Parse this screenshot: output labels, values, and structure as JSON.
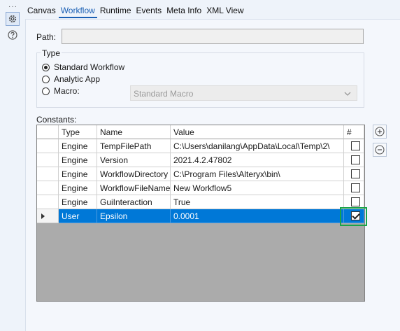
{
  "toolbar": {
    "dots": "···",
    "icons": [
      "gear-icon",
      "help-icon"
    ]
  },
  "tabs": [
    {
      "label": "Canvas",
      "active": false
    },
    {
      "label": "Workflow",
      "active": true
    },
    {
      "label": "Runtime",
      "active": false
    },
    {
      "label": "Events",
      "active": false
    },
    {
      "label": "Meta Info",
      "active": false
    },
    {
      "label": "XML View",
      "active": false
    }
  ],
  "path": {
    "label": "Path:",
    "value": ""
  },
  "type": {
    "legend": "Type",
    "options": [
      {
        "label": "Standard Workflow",
        "checked": true
      },
      {
        "label": "Analytic App",
        "checked": false
      },
      {
        "label": "Macro:",
        "checked": false
      }
    ],
    "macro_select": "Standard Macro"
  },
  "constants": {
    "label": "Constants:",
    "columns": [
      "Type",
      "Name",
      "Value",
      "#"
    ],
    "rows": [
      {
        "type": "Engine",
        "name": "TempFilePath",
        "value": "C:\\Users\\danilang\\AppData\\Local\\Temp\\2\\",
        "checked": false
      },
      {
        "type": "Engine",
        "name": "Version",
        "value": "2021.4.2.47802",
        "checked": false
      },
      {
        "type": "Engine",
        "name": "WorkflowDirectory",
        "value": "C:\\Program Files\\Alteryx\\bin\\",
        "checked": false
      },
      {
        "type": "Engine",
        "name": "WorkflowFileName",
        "value": "New Workflow5",
        "checked": false
      },
      {
        "type": "Engine",
        "name": "GuiInteraction",
        "value": "True",
        "checked": false
      },
      {
        "type": "User",
        "name": "Epsilon",
        "value": "0.0001",
        "checked": true,
        "selected": true
      }
    ]
  },
  "colors": {
    "accent": "#1a5fb4",
    "selection": "#0078d7",
    "highlight": "#1aa34a",
    "grid_empty": "#ababab"
  }
}
